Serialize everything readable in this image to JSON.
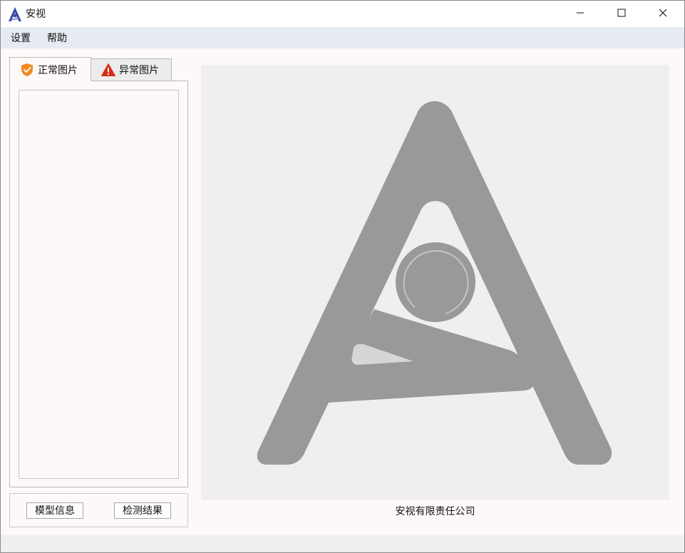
{
  "window": {
    "title": "安视",
    "icon": "app-logo-icon",
    "controls": [
      "minimize-icon",
      "maximize-icon",
      "close-icon"
    ]
  },
  "menu": {
    "items": [
      {
        "label": "设置"
      },
      {
        "label": "帮助"
      }
    ]
  },
  "tabs": [
    {
      "label": "正常图片",
      "icon": "shield-check-icon",
      "icon_color": "#f08a24",
      "selected": true
    },
    {
      "label": "异常图片",
      "icon": "warning-icon",
      "icon_color": "#d82c14",
      "selected": false
    }
  ],
  "buttons": {
    "model_info": "模型信息",
    "detect_result": "检测结果"
  },
  "display": {
    "logo": "company-logo-a",
    "logo_color": "#9a9898",
    "caption": "安视有限责任公司"
  },
  "colors": {
    "accent": "#3a4aa6",
    "menubar": "#e6ebf3"
  }
}
